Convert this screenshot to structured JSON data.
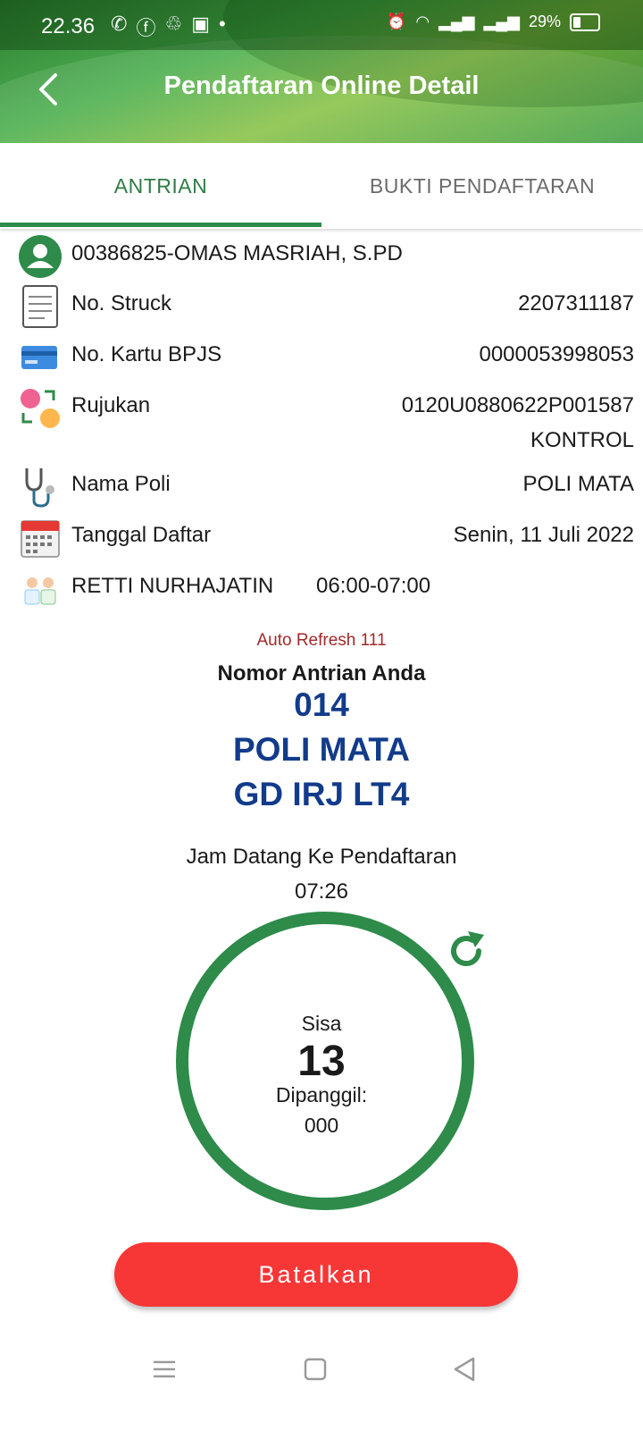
{
  "status_bar": {
    "time": "22.36",
    "battery": "29%"
  },
  "appbar": {
    "title": "Pendaftaran Online Detail"
  },
  "tabs": [
    {
      "label": "ANTRIAN",
      "active": true
    },
    {
      "label": "BUKTI PENDAFTARAN",
      "active": false
    }
  ],
  "patient": {
    "name": "00386825-OMAS MASRIAH, S.PD"
  },
  "details": {
    "struck_label": "No. Struck",
    "struck_value": "2207311187",
    "bpjs_label": "No. Kartu BPJS",
    "bpjs_value": "0000053998053",
    "rujukan_label": "Rujukan",
    "rujukan_value": "0120U0880622P001587",
    "rujukan_type": "KONTROL",
    "poli_label": "Nama Poli",
    "poli_value": "POLI MATA",
    "tanggal_label": "Tanggal Daftar",
    "tanggal_value": "Senin, 11 Juli 2022",
    "doctor_name": "RETTI NURHAJATIN",
    "doctor_time": "06:00-07:00"
  },
  "queue": {
    "auto_refresh": "Auto Refresh 111",
    "title": "Nomor Antrian Anda",
    "number": "014",
    "poli": "POLI MATA",
    "location": "GD IRJ LT4",
    "jam_label": "Jam Datang Ke Pendaftaran",
    "jam_value": "07:26",
    "sisa_label": "Sisa",
    "sisa_value": "13",
    "dipanggil_label": "Dipanggil:",
    "dipanggil_value": "000"
  },
  "actions": {
    "cancel_label": "Batalkan"
  },
  "colors": {
    "primary_green": "#2e8b4a",
    "queue_blue": "#123b8a",
    "cancel_red": "#f73636",
    "refresh_red": "#a02a2a"
  }
}
